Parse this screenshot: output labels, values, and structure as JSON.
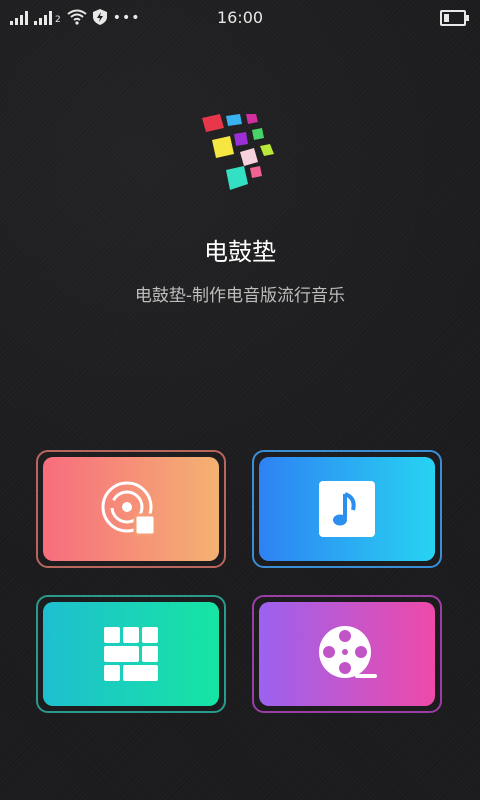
{
  "status_bar": {
    "time": "16:00",
    "sim_label": "2",
    "more": "•••",
    "icons": [
      "signal-icon",
      "signal-icon",
      "wifi-icon",
      "shield-icon",
      "battery-icon"
    ],
    "battery_level": 0.25
  },
  "app": {
    "title": "电鼓垫",
    "subtitle": "电鼓垫-制作电音版流行音乐",
    "logo_colors": [
      "#e8364a",
      "#3ab2f0",
      "#d02fa0",
      "#f6e642",
      "#9b2fd6",
      "#47d36a",
      "#f7d1dc",
      "#b7e83a",
      "#33e0c4",
      "#f06292"
    ]
  },
  "tiles": [
    {
      "icon": "disc-record-icon",
      "gradient": [
        "#f76d7d",
        "#f4b272"
      ]
    },
    {
      "icon": "music-note-icon",
      "gradient": [
        "#2e82f3",
        "#27d3f2"
      ]
    },
    {
      "icon": "grid-pad-icon",
      "gradient": [
        "#1ebfd0",
        "#16e5a2"
      ]
    },
    {
      "icon": "film-reel-icon",
      "gradient": [
        "#9b62f0",
        "#ee4aa8"
      ]
    }
  ]
}
